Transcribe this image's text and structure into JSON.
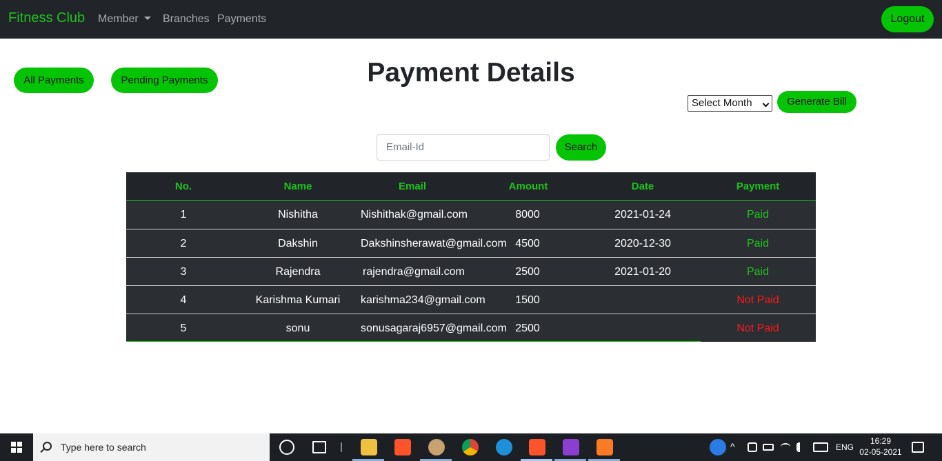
{
  "navbar": {
    "brand": "Fitness Club",
    "member": "Member",
    "branches": "Branches",
    "payments": "Payments",
    "logout": "Logout"
  },
  "actions": {
    "all_payments": "All Payments",
    "pending_payments": "Pending Payments",
    "month_select": "Select Month",
    "generate_bill": "Generate Bill",
    "search_placeholder": "Email-Id",
    "search": "Search"
  },
  "page": {
    "title": "Payment Details"
  },
  "table": {
    "headers": [
      "No.",
      "Name",
      "Email",
      "Amount",
      "Date",
      "Payment"
    ],
    "rows": [
      {
        "no": "1",
        "name": "Nishitha",
        "email": "Nishithak@gmail.com",
        "amount": "8000",
        "date": "2021-01-24",
        "payment": "Paid"
      },
      {
        "no": "2",
        "name": "Dakshin",
        "email": "Dakshinsherawat@gmail.com",
        "amount": "4500",
        "date": "2020-12-30",
        "payment": "Paid"
      },
      {
        "no": "3",
        "name": "Rajendra",
        "email": "rajendra@gmail.com",
        "amount": "2500",
        "date": "2021-01-20",
        "payment": "Paid"
      },
      {
        "no": "4",
        "name": "Karishma Kumari",
        "email": "karishma234@gmail.com",
        "amount": "1500",
        "date": "",
        "payment": "Not Paid"
      },
      {
        "no": "5",
        "name": "sonu",
        "email": "sonusagaraj6957@gmail.com",
        "amount": "2500",
        "date": "",
        "payment": "Not Paid"
      }
    ]
  },
  "colors": {
    "accent": "#05c405",
    "navbar": "#212529",
    "paid": "#1fc21f",
    "not_paid": "#ff1a1a"
  },
  "taskbar": {
    "search_text": "Type here to search",
    "language": "ENG",
    "time": "16:29",
    "date": "02-05-2021"
  }
}
